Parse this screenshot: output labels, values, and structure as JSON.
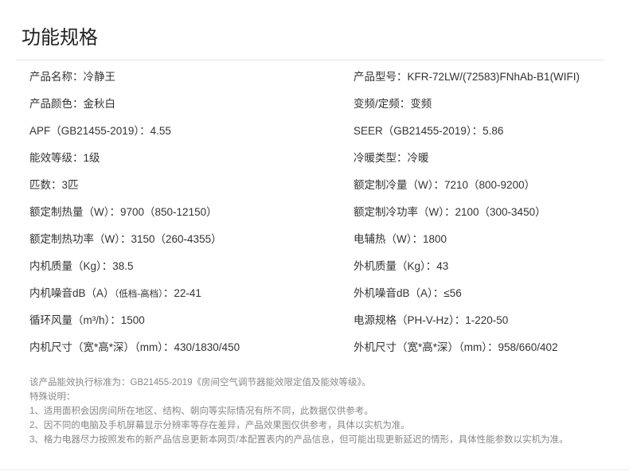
{
  "page": {
    "title": "功能规格"
  },
  "specs": [
    {
      "left": {
        "label": "产品名称：",
        "value": "冷静王"
      },
      "right": {
        "label": "产品型号：",
        "value": "KFR-72LW/(72583)FNhAb-B1(WIFI)"
      }
    },
    {
      "left": {
        "label": "产品颜色：",
        "value": "金秋白"
      },
      "right": {
        "label": "变频/定频：",
        "value": "变频"
      }
    },
    {
      "left": {
        "label": "APF（GB21455-2019）：",
        "value": "4.55"
      },
      "right": {
        "label": "SEER（GB21455-2019）：",
        "value": "5.86"
      }
    },
    {
      "left": {
        "label": "能效等级：",
        "value": "1级"
      },
      "right": {
        "label": "冷暖类型：",
        "value": "冷暖"
      }
    },
    {
      "left": {
        "label": "匹数：",
        "value": "3匹"
      },
      "right": {
        "label": "额定制冷量（W）：",
        "value": "7210（800-9200）"
      }
    },
    {
      "left": {
        "label": "额定制热量（W）：",
        "value": "9700（850-12150）"
      },
      "right": {
        "label": "额定制冷功率（W）：",
        "value": "2100（300-3450）"
      }
    },
    {
      "left": {
        "label": "额定制热功率（W）：",
        "value": "3150（260-4355）"
      },
      "right": {
        "label": "电辅热（W）：",
        "value": "1800"
      }
    },
    {
      "left": {
        "label": "内机质量（Kg）：",
        "value": "38.5"
      },
      "right": {
        "label": "外机质量（Kg）：",
        "value": "43"
      }
    },
    {
      "left": {
        "label": "内机噪音dB（A）",
        "note": "（低档-高档）",
        "label_tail": "：",
        "value": "22-41"
      },
      "right": {
        "label": "外机噪音dB（A）：",
        "value": "≤56"
      }
    },
    {
      "left": {
        "label": "循环风量（m³/h）：",
        "value": "1500"
      },
      "right": {
        "label": "电源规格（PH-V-Hz）：",
        "value": "1-220-50"
      }
    },
    {
      "left": {
        "label": "内机尺寸（宽*高*深）（mm）：",
        "value": "430/1830/450"
      },
      "right": {
        "label": "外机尺寸（宽*高*深）（mm）：",
        "value": "958/660/402"
      }
    }
  ],
  "notes": {
    "standard": "该产品能效执行标准为：GB21455-2019《房间空气调节器能效限定值及能效等级》。",
    "heading": "特殊说明：",
    "items": [
      "1、适用面积会因房间所在地区、结构、朝向等实际情况有所不同，此数据仅供参考。",
      "2、因不同的电脑及手机屏幕显示分辨率等存在差异，产品效果图仅供参考，具体以实机为准。",
      "3、格力电器尽力按照发布的新产品信息更新本网页/本配置表内的产品信息，但可能出现更新延迟的情形，具体性能参数以实机为准。"
    ]
  }
}
